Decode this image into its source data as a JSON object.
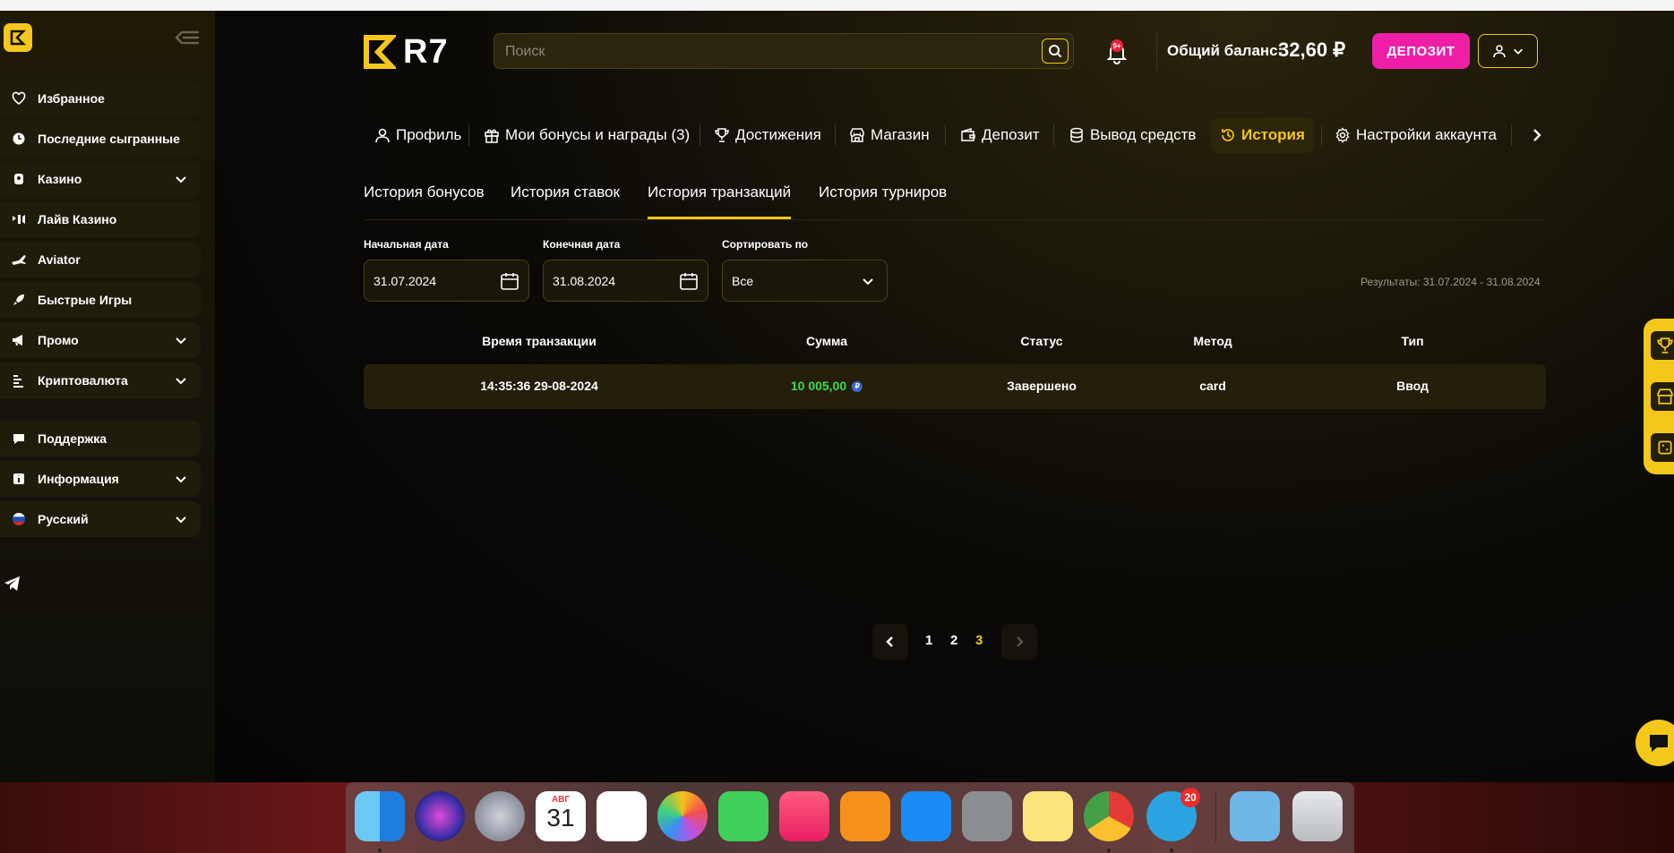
{
  "header": {
    "brand": "R7",
    "search_placeholder": "Поиск",
    "notification_badge": "9+",
    "balance_label": "Общий баланс:",
    "balance_value": "32,60 ₽",
    "deposit_label": "ДЕПОЗИТ"
  },
  "sidebar": {
    "items": [
      {
        "label": "Избранное",
        "icon": "heart-icon"
      },
      {
        "label": "Последние сыгранные",
        "icon": "clock-icon"
      },
      {
        "label": "Казино",
        "icon": "casino-icon",
        "expandable": true
      },
      {
        "label": "Лайв Казино",
        "icon": "live-icon"
      },
      {
        "label": "Aviator",
        "icon": "plane-icon"
      },
      {
        "label": "Быстрые Игры",
        "icon": "rocket-icon"
      },
      {
        "label": "Промо",
        "icon": "megaphone-icon",
        "expandable": true
      },
      {
        "label": "Криптовалюта",
        "icon": "crypto-icon",
        "expandable": true
      },
      {
        "label": "Поддержка",
        "icon": "support-icon"
      },
      {
        "label": "Информация",
        "icon": "info-icon",
        "expandable": true
      },
      {
        "label": "Русский",
        "icon": "russia-flag-icon",
        "expandable": true
      }
    ]
  },
  "nav": {
    "tabs": [
      {
        "label": "Профиль",
        "icon": "user-icon"
      },
      {
        "label": "Мои бонусы и награды (3)",
        "icon": "gift-icon"
      },
      {
        "label": "Достижения",
        "icon": "trophy-icon"
      },
      {
        "label": "Магазин",
        "icon": "store-icon"
      },
      {
        "label": "Депозит",
        "icon": "wallet-icon"
      },
      {
        "label": "Вывод средств",
        "icon": "coins-icon"
      },
      {
        "label": "История",
        "icon": "history-icon",
        "active": true
      },
      {
        "label": "Настройки аккаунта",
        "icon": "settings-icon"
      }
    ]
  },
  "subtabs": [
    {
      "label": "История бонусов"
    },
    {
      "label": "История ставок"
    },
    {
      "label": "История транзакций",
      "active": true
    },
    {
      "label": "История турниров"
    }
  ],
  "filters": {
    "start_label": "Начальная дата",
    "start_value": "31.07.2024",
    "end_label": "Конечная дата",
    "end_value": "31.08.2024",
    "sort_label": "Сортировать по",
    "sort_value": "Все",
    "results": "Результаты: 31.07.2024 - 31.08.2024"
  },
  "table": {
    "columns": [
      "Время транзакции",
      "Сумма",
      "Статус",
      "Метод",
      "Тип"
    ],
    "rows": [
      {
        "time": "14:35:36 29-08-2024",
        "amount": "10 005,00",
        "currency": "₽",
        "status": "Завершено",
        "method": "card",
        "type": "Ввод"
      }
    ]
  },
  "pagination": {
    "pages": [
      "1",
      "2",
      "3"
    ],
    "current": "3"
  },
  "dock": {
    "calendar_month": "АВГ",
    "calendar_day": "31",
    "telegram_badge": "20"
  },
  "colors": {
    "accent": "#f5c61b",
    "deposit": "#ee1fa6",
    "amount": "#3ddc4a"
  }
}
